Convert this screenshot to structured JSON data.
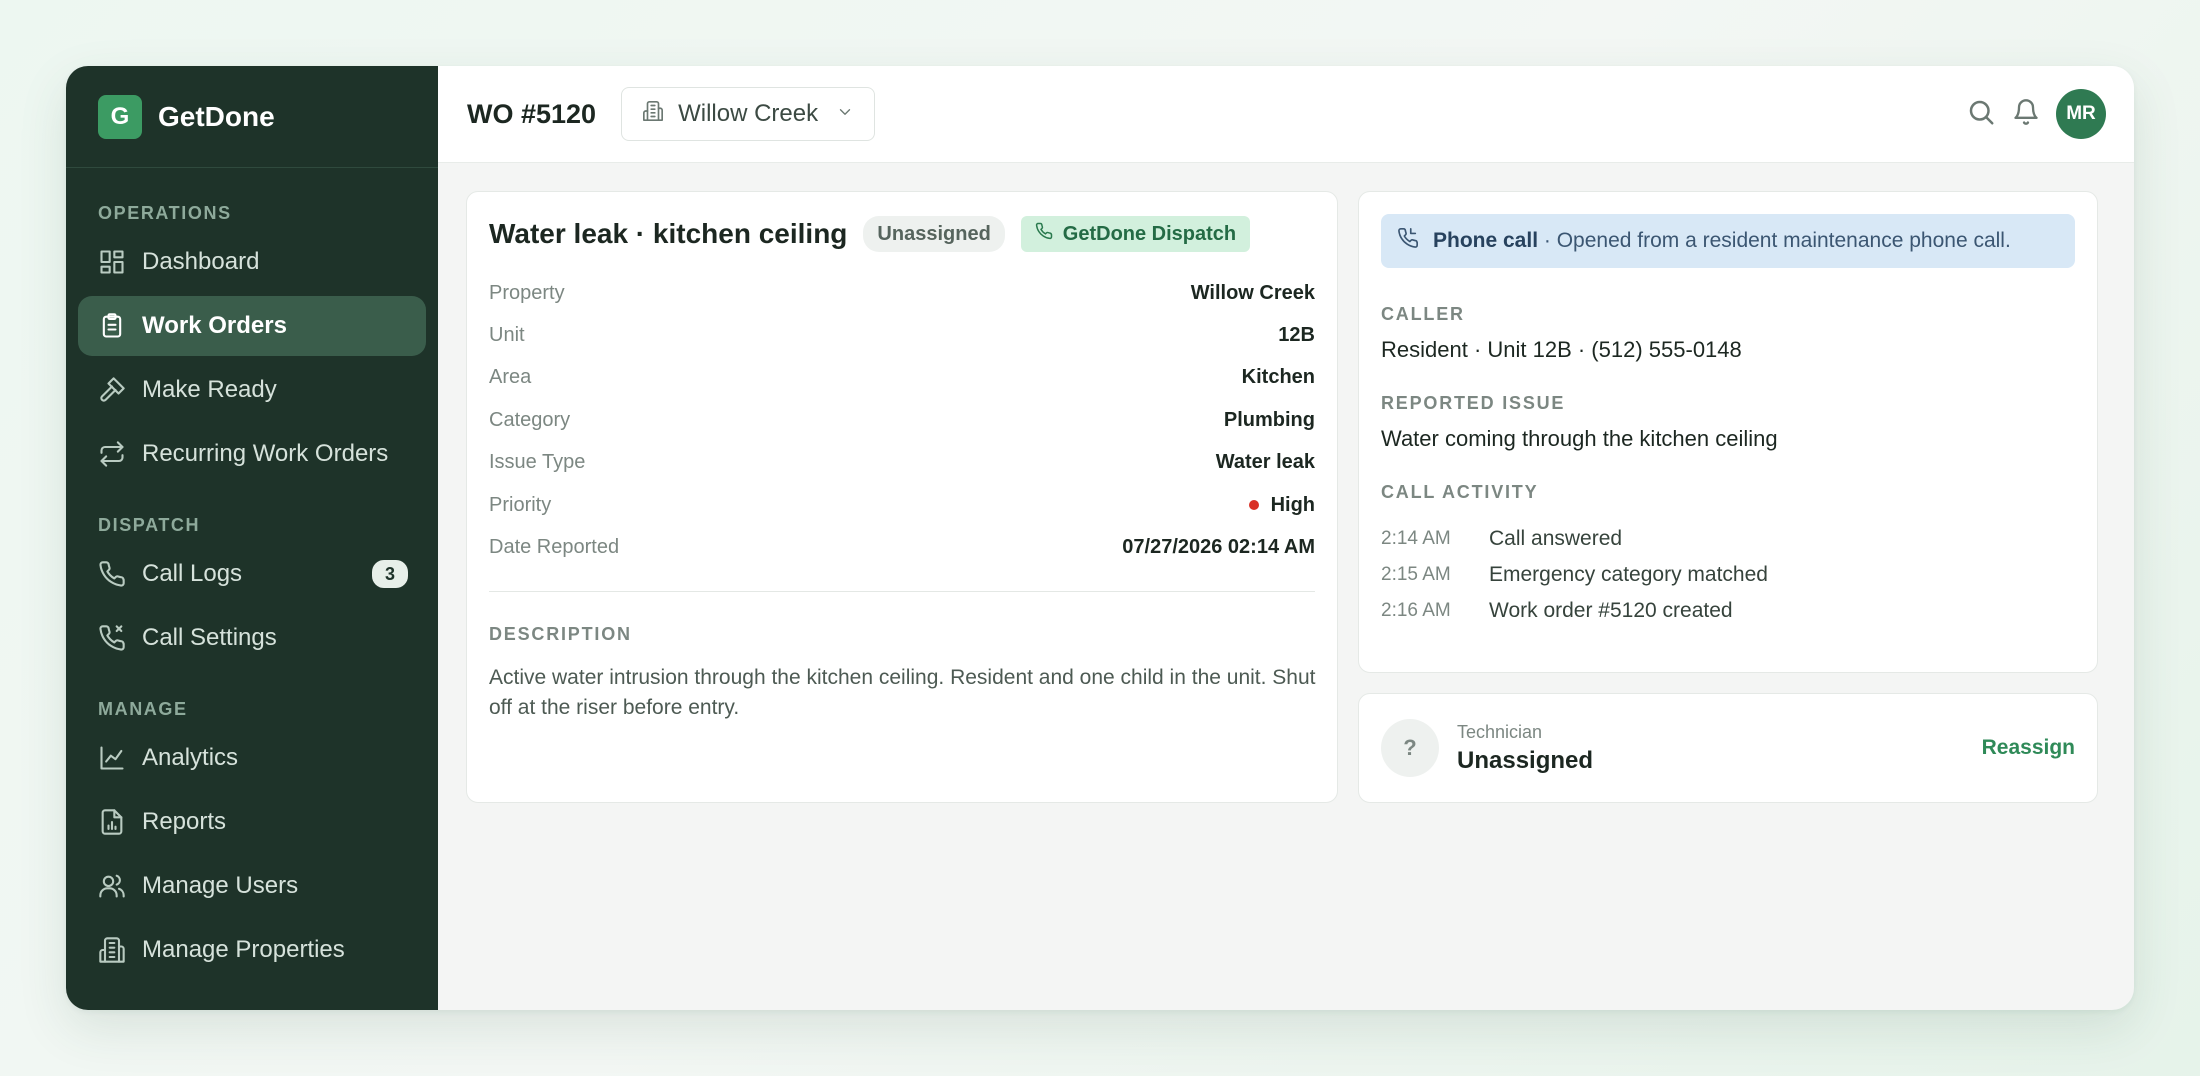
{
  "brand": {
    "logo_letter": "G",
    "name": "GetDone"
  },
  "sidebar": {
    "sections": [
      {
        "heading": "OPERATIONS",
        "items": [
          {
            "label": "Dashboard",
            "icon": "dashboard-icon"
          },
          {
            "label": "Work Orders",
            "icon": "clipboard-icon",
            "active": true
          },
          {
            "label": "Make Ready",
            "icon": "hammer-icon"
          },
          {
            "label": "Recurring Work Orders",
            "icon": "repeat-icon"
          }
        ]
      },
      {
        "heading": "DISPATCH",
        "items": [
          {
            "label": "Call Logs",
            "icon": "phone-icon",
            "badge": "3"
          },
          {
            "label": "Call Settings",
            "icon": "phone-settings-icon"
          }
        ]
      },
      {
        "heading": "MANAGE",
        "items": [
          {
            "label": "Analytics",
            "icon": "line-chart-icon"
          },
          {
            "label": "Reports",
            "icon": "file-chart-icon"
          },
          {
            "label": "Manage Users",
            "icon": "users-icon"
          },
          {
            "label": "Manage Properties",
            "icon": "building-icon"
          }
        ]
      }
    ]
  },
  "header": {
    "title": "WO #5120",
    "property_select": "Willow Creek",
    "avatar_initials": "MR"
  },
  "details": {
    "title": "Water leak · kitchen ceiling",
    "status_badge": "Unassigned",
    "source_badge": "GetDone Dispatch",
    "fields": [
      {
        "label": "Property",
        "value": "Willow Creek"
      },
      {
        "label": "Unit",
        "value": "12B"
      },
      {
        "label": "Area",
        "value": "Kitchen"
      },
      {
        "label": "Category",
        "value": "Plumbing"
      },
      {
        "label": "Issue Type",
        "value": "Water leak"
      },
      {
        "label": "Priority",
        "value": "High"
      },
      {
        "label": "Date Reported",
        "value": "07/27/2026 02:14 AM"
      }
    ],
    "description_label": "DESCRIPTION",
    "description": "Active water intrusion through the kitchen ceiling. Resident and one child in the unit. Shut off at the riser before entry."
  },
  "call": {
    "banner_strong": "Phone call",
    "banner_text": " · Opened from a resident maintenance phone call.",
    "caller_label": "CALLER",
    "caller_value": "Resident · Unit 12B · (512) 555-0148",
    "issue_label": "REPORTED ISSUE",
    "issue_value": "Water coming through the kitchen ceiling",
    "activity_label": "CALL ACTIVITY",
    "activity": [
      {
        "time": "2:14 AM",
        "text": "Call answered"
      },
      {
        "time": "2:15 AM",
        "text": "Emergency category matched"
      },
      {
        "time": "2:16 AM",
        "text": "Work order #5120 created"
      }
    ]
  },
  "technician": {
    "avatar": "?",
    "role": "Technician",
    "name": "Unassigned",
    "action": "Reassign"
  },
  "colors": {
    "sidebar_bg": "#1e3329",
    "accent": "#3c9b63",
    "priority_high": "#d93025",
    "banner_bg": "#d8e8f6"
  }
}
